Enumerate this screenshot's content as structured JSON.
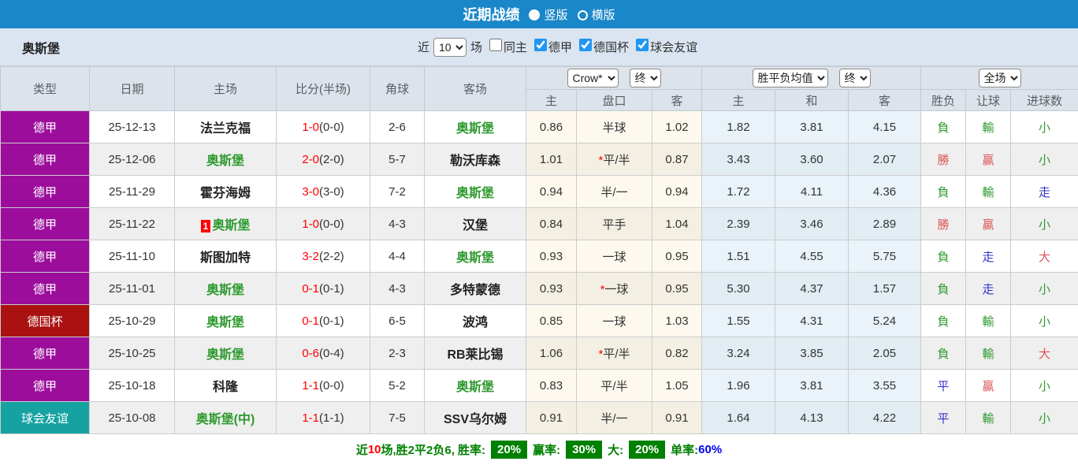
{
  "title_bar": {
    "title": "近期战绩",
    "radios": [
      {
        "label": "竖版",
        "selected": true
      },
      {
        "label": "横版",
        "selected": false
      }
    ]
  },
  "filter_bar": {
    "team": "奥斯堡",
    "near_label": "近",
    "count_value": "10",
    "games_label": "场",
    "checkboxes": [
      {
        "label": "同主",
        "checked": false
      },
      {
        "label": "德甲",
        "checked": true
      },
      {
        "label": "德国杯",
        "checked": true
      },
      {
        "label": "球会友谊",
        "checked": true
      }
    ]
  },
  "table": {
    "left_headers": [
      "类型",
      "日期",
      "主场",
      "比分(半场)",
      "角球",
      "客场"
    ],
    "selects": {
      "company": "Crow*",
      "company_time": "终",
      "avg": "胜平负均值",
      "avg_time": "终",
      "scope": "全场"
    },
    "sub_headers": [
      "主",
      "盘口",
      "客",
      "主",
      "和",
      "客",
      "胜负",
      "让球",
      "进球数"
    ],
    "rows": [
      {
        "type": "德甲",
        "date": "25-12-13",
        "home": {
          "text": "法兰克福",
          "green": false
        },
        "score": "1-0",
        "half": "(0-0)",
        "corner": "2-6",
        "away": {
          "text": "奥斯堡",
          "green": true
        },
        "odds": [
          "0.86",
          "半球",
          "1.02"
        ],
        "handicap_star": false,
        "avg": [
          "1.82",
          "3.81",
          "4.15"
        ],
        "results": [
          {
            "t": "負",
            "c": "green"
          },
          {
            "t": "輸",
            "c": "green"
          },
          {
            "t": "小",
            "c": "green"
          }
        ]
      },
      {
        "type": "德甲",
        "date": "25-12-06",
        "home": {
          "text": "奥斯堡",
          "green": true
        },
        "score": "2-0",
        "half": "(2-0)",
        "corner": "5-7",
        "away": {
          "text": "勒沃库森",
          "green": false
        },
        "odds": [
          "1.01",
          "平/半",
          "0.87"
        ],
        "handicap_star": true,
        "avg": [
          "3.43",
          "3.60",
          "2.07"
        ],
        "results": [
          {
            "t": "勝",
            "c": "red"
          },
          {
            "t": "贏",
            "c": "red"
          },
          {
            "t": "小",
            "c": "green"
          }
        ]
      },
      {
        "type": "德甲",
        "date": "25-11-29",
        "home": {
          "text": "霍芬海姆",
          "green": false
        },
        "score": "3-0",
        "half": "(3-0)",
        "corner": "7-2",
        "away": {
          "text": "奥斯堡",
          "green": true
        },
        "odds": [
          "0.94",
          "半/一",
          "0.94"
        ],
        "handicap_star": false,
        "avg": [
          "1.72",
          "4.11",
          "4.36"
        ],
        "results": [
          {
            "t": "負",
            "c": "green"
          },
          {
            "t": "輸",
            "c": "green"
          },
          {
            "t": "走",
            "c": "blue"
          }
        ]
      },
      {
        "type": "德甲",
        "date": "25-11-22",
        "home": {
          "text": "奥斯堡",
          "green": true,
          "rank": "1"
        },
        "score": "1-0",
        "half": "(0-0)",
        "corner": "4-3",
        "away": {
          "text": "汉堡",
          "green": false
        },
        "odds": [
          "0.84",
          "平手",
          "1.04"
        ],
        "handicap_star": false,
        "avg": [
          "2.39",
          "3.46",
          "2.89"
        ],
        "results": [
          {
            "t": "勝",
            "c": "red"
          },
          {
            "t": "贏",
            "c": "red"
          },
          {
            "t": "小",
            "c": "green"
          }
        ]
      },
      {
        "type": "德甲",
        "date": "25-11-10",
        "home": {
          "text": "斯图加特",
          "green": false
        },
        "score": "3-2",
        "half": "(2-2)",
        "corner": "4-4",
        "away": {
          "text": "奥斯堡",
          "green": true
        },
        "odds": [
          "0.93",
          "一球",
          "0.95"
        ],
        "handicap_star": false,
        "avg": [
          "1.51",
          "4.55",
          "5.75"
        ],
        "results": [
          {
            "t": "負",
            "c": "green"
          },
          {
            "t": "走",
            "c": "blue"
          },
          {
            "t": "大",
            "c": "red"
          }
        ]
      },
      {
        "type": "德甲",
        "date": "25-11-01",
        "home": {
          "text": "奥斯堡",
          "green": true
        },
        "score": "0-1",
        "half": "(0-1)",
        "corner": "4-3",
        "away": {
          "text": "多特蒙德",
          "green": false
        },
        "odds": [
          "0.93",
          "一球",
          "0.95"
        ],
        "handicap_star": true,
        "avg": [
          "5.30",
          "4.37",
          "1.57"
        ],
        "results": [
          {
            "t": "負",
            "c": "green"
          },
          {
            "t": "走",
            "c": "blue"
          },
          {
            "t": "小",
            "c": "green"
          }
        ]
      },
      {
        "type": "德国杯",
        "date": "25-10-29",
        "home": {
          "text": "奥斯堡",
          "green": true
        },
        "score": "0-1",
        "half": "(0-1)",
        "corner": "6-5",
        "away": {
          "text": "波鸿",
          "green": false
        },
        "odds": [
          "0.85",
          "一球",
          "1.03"
        ],
        "handicap_star": false,
        "avg": [
          "1.55",
          "4.31",
          "5.24"
        ],
        "results": [
          {
            "t": "負",
            "c": "green"
          },
          {
            "t": "輸",
            "c": "green"
          },
          {
            "t": "小",
            "c": "green"
          }
        ]
      },
      {
        "type": "德甲",
        "date": "25-10-25",
        "home": {
          "text": "奥斯堡",
          "green": true
        },
        "score": "0-6",
        "half": "(0-4)",
        "corner": "2-3",
        "away": {
          "text": "RB莱比锡",
          "green": false
        },
        "odds": [
          "1.06",
          "平/半",
          "0.82"
        ],
        "handicap_star": true,
        "avg": [
          "3.24",
          "3.85",
          "2.05"
        ],
        "results": [
          {
            "t": "負",
            "c": "green"
          },
          {
            "t": "輸",
            "c": "green"
          },
          {
            "t": "大",
            "c": "red"
          }
        ]
      },
      {
        "type": "德甲",
        "date": "25-10-18",
        "home": {
          "text": "科隆",
          "green": false
        },
        "score": "1-1",
        "half": "(0-0)",
        "corner": "5-2",
        "away": {
          "text": "奥斯堡",
          "green": true
        },
        "odds": [
          "0.83",
          "平/半",
          "1.05"
        ],
        "handicap_star": false,
        "avg": [
          "1.96",
          "3.81",
          "3.55"
        ],
        "results": [
          {
            "t": "平",
            "c": "blue"
          },
          {
            "t": "贏",
            "c": "red"
          },
          {
            "t": "小",
            "c": "green"
          }
        ]
      },
      {
        "type": "球会友谊",
        "date": "25-10-08",
        "home": {
          "text": "奥斯堡(中)",
          "green": true
        },
        "score": "1-1",
        "half": "(1-1)",
        "corner": "7-5",
        "away": {
          "text": "SSV乌尔姆",
          "green": false
        },
        "odds": [
          "0.91",
          "半/一",
          "0.91"
        ],
        "handicap_star": false,
        "avg": [
          "1.64",
          "4.13",
          "4.22"
        ],
        "results": [
          {
            "t": "平",
            "c": "blue"
          },
          {
            "t": "輸",
            "c": "green"
          },
          {
            "t": "小",
            "c": "green"
          }
        ]
      }
    ]
  },
  "footer": {
    "near": "近",
    "count": "10",
    "summary": "场,胜2平2负6, 胜率:",
    "rate1": "20%",
    "label2": "赢率:",
    "rate2": "30%",
    "label3": "大:",
    "rate3": "20%",
    "label4": "单率:",
    "rate4": "60%"
  },
  "colors": {
    "topbar": "#1a87c9",
    "filterbar": "#dbe5f1",
    "header_bg": "#dde3ea",
    "header_text": "#5a5f66",
    "row_alt": "#efefef",
    "odds_bg": "#fdf9ef",
    "odds_alt": "#f4efe3",
    "avg_bg": "#e9f3f9",
    "avg_alt": "#e2ecf3",
    "team_green": "#2f9a2f",
    "score_red": "#ff0000",
    "res_green": "#2f9a2f",
    "res_red": "#dd5555",
    "res_blue": "#3333cc",
    "footer_green": "#008000",
    "pct_bg": "#008000",
    "single_blue": "#0000ee",
    "checkbox_blue": "#2196f3",
    "league": {
      "德甲": "#9c0d9c",
      "德国杯": "#aa1212",
      "球会友谊": "#17a2a2"
    }
  }
}
